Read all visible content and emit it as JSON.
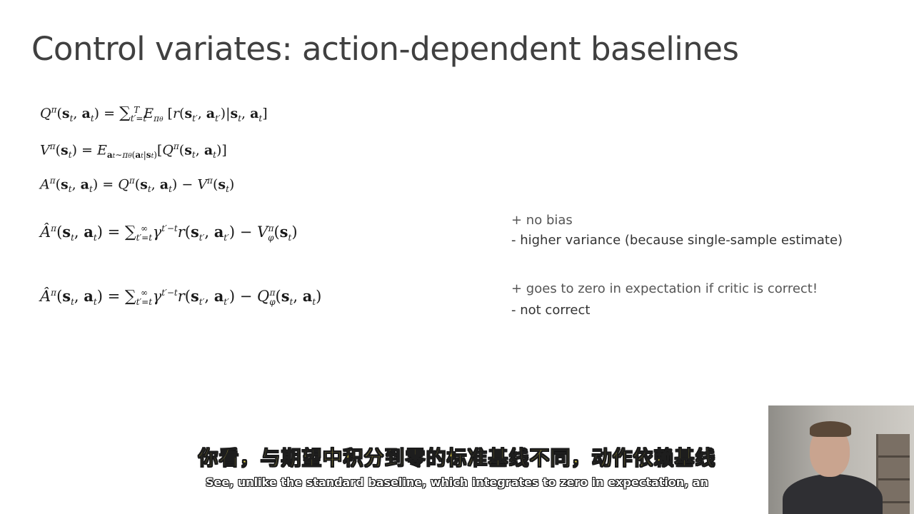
{
  "watermark": "",
  "slide": {
    "title": "Control variates: action-dependent baselines"
  },
  "equations": [
    "Q^π(s_t, a_t) = Σ_{t'=t}^{T} E_{π_θ}[r(s_{t'}, a_{t'}) | s_t, a_t]",
    "V^π(s_t) = E_{a_t ~ π_θ(a_t|s_t)}[Q^π(s_t, a_t)]",
    "A^π(s_t, a_t) = Q^π(s_t, a_t) − V^π(s_t)",
    "Â^π(s_t, a_t) = Σ_{t'=t}^{∞} γ^{t'−t} r(s_{t'}, a_{t'}) − V_φ^π(s_t)",
    "Â^π(s_t, a_t) = Σ_{t'=t}^{∞} γ^{t'−t} r(s_{t'}, a_{t'}) − Q_φ^π(s_t, a_t)"
  ],
  "notes": {
    "first": [
      "+ no bias",
      "- higher variance (because single-sample estimate)"
    ],
    "second": [
      "+ goes to zero in expectation if critic is correct!",
      "- not correct"
    ]
  },
  "subtitles": {
    "chinese": "你看，与期望中积分到零的标准基线不同，动作依赖基线",
    "english": "See, unlike the standard baseline, which integrates to zero in expectation, an"
  }
}
